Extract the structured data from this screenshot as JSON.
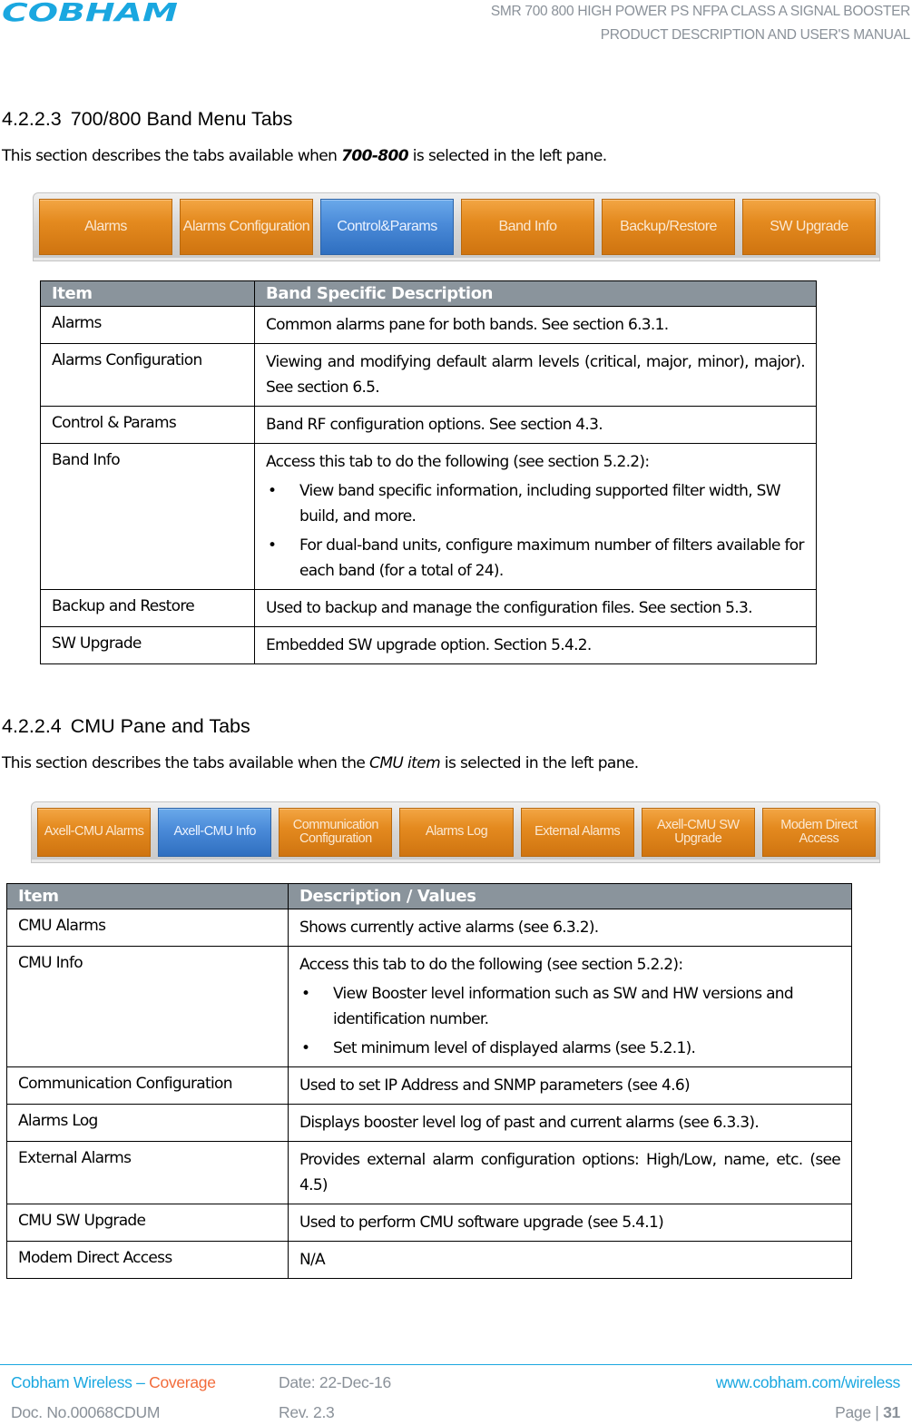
{
  "header": {
    "logo_text": "COBHAM",
    "title_line1": "SMR 700 800 HIGH POWER PS NFPA CLASS A SIGNAL BOOSTER",
    "title_line2": "PRODUCT DESCRIPTION AND USER'S MANUAL"
  },
  "section1": {
    "number": "4.2.2.3",
    "title": "700/800 Band Menu Tabs",
    "intro_before": "This section describes the tabs available when ",
    "intro_emphasis": "700-800",
    "intro_after": " is selected in the left pane.",
    "tabs": [
      {
        "label": "Alarms",
        "active": false
      },
      {
        "label": "Alarms Configuration",
        "active": false
      },
      {
        "label": "Control&Params",
        "active": true
      },
      {
        "label": "Band Info",
        "active": false
      },
      {
        "label": "Backup/Restore",
        "active": false
      },
      {
        "label": "SW Upgrade",
        "active": false
      }
    ],
    "table": {
      "headers": [
        "Item",
        "Band Specific Description"
      ],
      "rows": [
        {
          "item": "Alarms",
          "desc": "Common alarms pane for both bands. See section 6.3.1."
        },
        {
          "item": "Alarms Configuration",
          "desc": "Viewing and modifying default alarm levels (critical, major, minor), major). See section 6.5."
        },
        {
          "item": "Control & Params",
          "desc": "Band RF configuration options.  See section 4.3."
        },
        {
          "item": "Band Info",
          "desc": "Access this tab to do the following (see section 5.2.2):",
          "bullets": [
            "View band specific information, including supported filter width, SW build, and more.",
            "For dual-band units, configure maximum number of filters available for each band (for a total of 24)."
          ]
        },
        {
          "item": "Backup and Restore",
          "desc": "Used to backup and manage the configuration files. See section 5.3."
        },
        {
          "item": "SW Upgrade",
          "desc": "Embedded SW upgrade option. Section 5.4.2."
        }
      ]
    }
  },
  "section2": {
    "number": "4.2.2.4",
    "title": "CMU Pane and Tabs",
    "intro_before": "This section describes the tabs available when the ",
    "intro_emphasis": "CMU item",
    "intro_after": " is selected in the left pane.",
    "tabs": [
      {
        "label": "Axell-CMU Alarms",
        "active": false
      },
      {
        "label": "Axell-CMU Info",
        "active": true
      },
      {
        "label": "Communication Configuration",
        "active": false
      },
      {
        "label": "Alarms Log",
        "active": false
      },
      {
        "label": "External Alarms",
        "active": false
      },
      {
        "label": "Axell-CMU SW Upgrade",
        "active": false
      },
      {
        "label": "Modem Direct Access",
        "active": false
      }
    ],
    "table": {
      "headers": [
        "Item",
        "Description / Values"
      ],
      "rows": [
        {
          "item": "CMU Alarms",
          "desc": "Shows currently active alarms (see 6.3.2)."
        },
        {
          "item": "CMU Info",
          "desc": "Access this tab to do the following (see section 5.2.2):",
          "bullets": [
            "View Booster level information such as SW and HW versions and identification number.",
            "Set minimum level of displayed alarms (see 5.2.1)."
          ]
        },
        {
          "item": "Communication Configuration",
          "desc": "Used to set IP Address and SNMP parameters (see 4.6)"
        },
        {
          "item": "Alarms Log",
          "desc": "Displays booster level log of past and current alarms (see 6.3.3)."
        },
        {
          "item": "External Alarms",
          "desc": "Provides external alarm configuration options: High/Low, name, etc. (see 4.5)"
        },
        {
          "item": "CMU SW Upgrade",
          "desc": "Used to perform CMU software upgrade (see 5.4.1)"
        },
        {
          "item": "Modem Direct Access",
          "desc": "N/A"
        }
      ]
    }
  },
  "footer": {
    "company": "Cobham Wireless – ",
    "division": "Coverage",
    "date": "Date: 22-Dec-16",
    "website": "www.cobham.com/wireless",
    "doc_no": "Doc. No.00068CDUM",
    "rev": "Rev. 2.3",
    "page_label": "Page | ",
    "page_number": "31"
  },
  "colors": {
    "brand_blue": "#1aa7e0",
    "accent_orange": "#f26b3a",
    "tab_orange": "#e48a1f",
    "tab_active_blue": "#4a8ad8",
    "table_header": "#8a949c"
  }
}
